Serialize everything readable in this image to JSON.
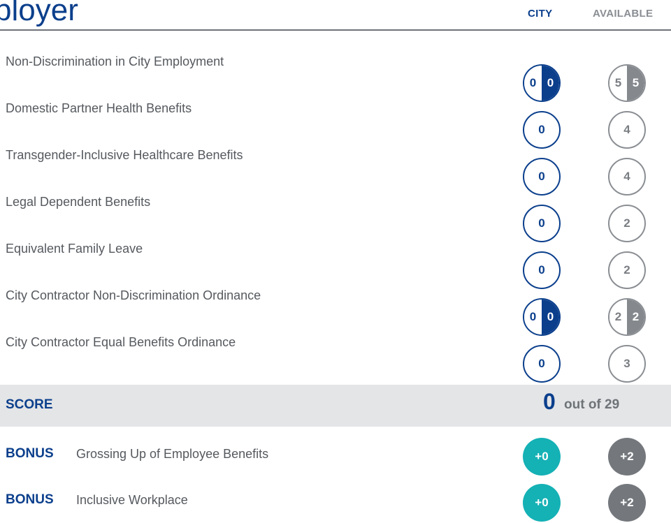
{
  "header": {
    "title": "ployer",
    "col_city": "CITY",
    "col_available": "AVAILABLE"
  },
  "rows": [
    {
      "label": "Non-Discrimination in City Employment",
      "city_left": "0",
      "city_right": "0",
      "avail_left": "5",
      "avail_right": "5"
    },
    {
      "label": "Domestic Partner Health Benefits",
      "city": "0",
      "available": "4"
    },
    {
      "label": "Transgender-Inclusive Healthcare Benefits",
      "city": "0",
      "available": "4"
    },
    {
      "label": "Legal Dependent Benefits",
      "city": "0",
      "available": "2"
    },
    {
      "label": "Equivalent Family Leave",
      "city": "0",
      "available": "2"
    },
    {
      "label": "City Contractor Non-Discrimination Ordinance",
      "city_left": "0",
      "city_right": "0",
      "avail_left": "2",
      "avail_right": "2"
    },
    {
      "label": "City Contractor Equal Benefits Ordinance",
      "city": "0",
      "available": "3"
    }
  ],
  "score": {
    "label": "SCORE",
    "value": "0",
    "out_of": "out of 29"
  },
  "bonus": [
    {
      "tag": "BONUS",
      "label": "Grossing Up of Employee Benefits",
      "city": "+0",
      "available": "+2"
    },
    {
      "tag": "BONUS",
      "label": "Inclusive Workplace",
      "city": "+0",
      "available": "+2"
    }
  ],
  "colors": {
    "brand_blue": "#0b3f8c",
    "gray": "#85898e",
    "teal": "#14b1b5",
    "band": "#e4e5e7"
  }
}
